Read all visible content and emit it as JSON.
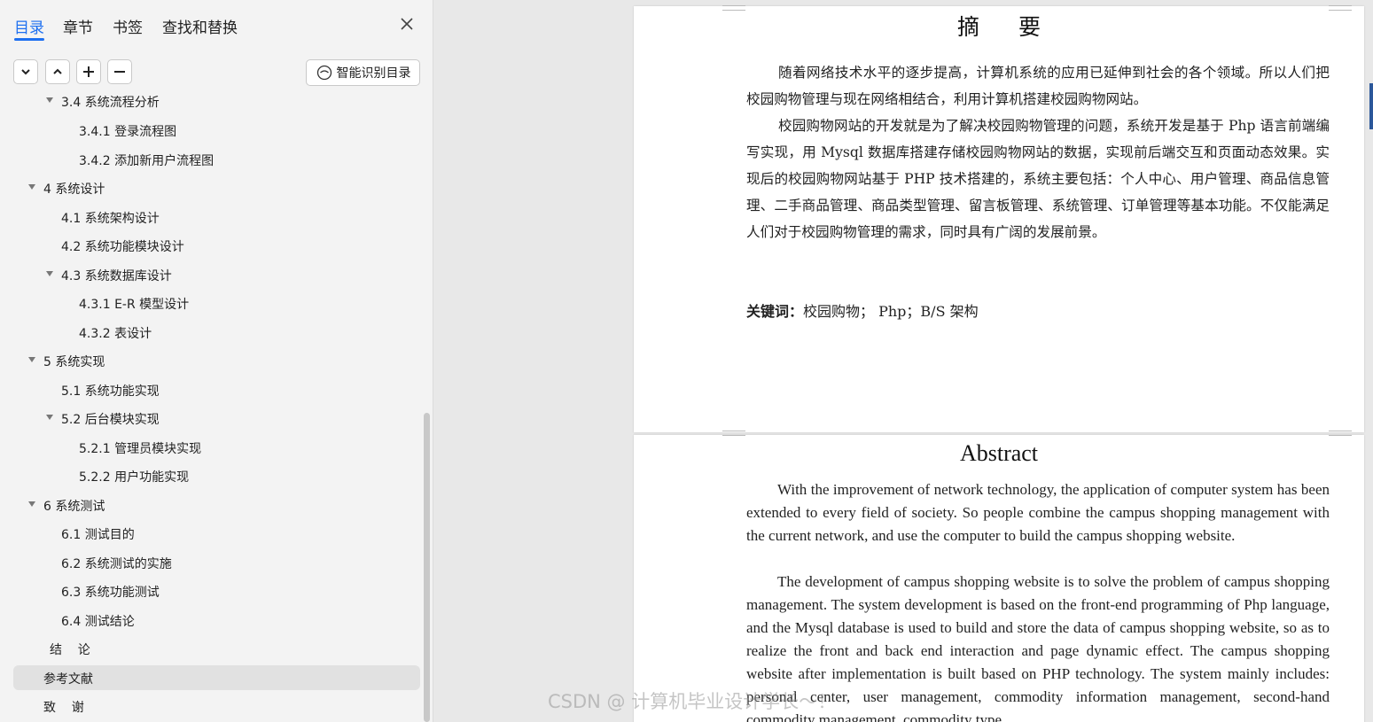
{
  "sidebar": {
    "tabs": [
      {
        "label": "目录"
      },
      {
        "label": "章节"
      },
      {
        "label": "书签"
      },
      {
        "label": "查找和替换"
      }
    ],
    "smart_toc_label": "智能识别目录",
    "toc": [
      {
        "label": "3.4 系统流程分析"
      },
      {
        "label": "3.4.1 登录流程图"
      },
      {
        "label": "3.4.2 添加新用户流程图"
      },
      {
        "label": "4  系统设计"
      },
      {
        "label": "4.1 系统架构设计"
      },
      {
        "label": "4.2 系统功能模块设计"
      },
      {
        "label": "4.3 系统数据库设计"
      },
      {
        "label": "4.3.1 E-R 模型设计"
      },
      {
        "label": "4.3.2 表设计"
      },
      {
        "label": "5 系统实现"
      },
      {
        "label": "5.1 系统功能实现"
      },
      {
        "label": "5.2 后台模块实现"
      },
      {
        "label": "5.2.1 管理员模块实现"
      },
      {
        "label": "5.2.2 用户功能实现"
      },
      {
        "label": "6  系统测试"
      },
      {
        "label": "6.1 测试目的"
      },
      {
        "label": "6.2 系统测试的实施"
      },
      {
        "label": "6.3 系统功能测试"
      },
      {
        "label": "6.4 测试结论"
      },
      {
        "label": "结    论"
      },
      {
        "label": "参考文献"
      },
      {
        "label": "致    谢"
      }
    ]
  },
  "document": {
    "page1": {
      "title": "摘 要",
      "paragraphs": [
        "随着网络技术水平的逐步提高，计算机系统的应用已延伸到社会的各个领域。所以人们把校园购物管理与现在网络相结合，利用计算机搭建校园购物网站。",
        "校园购物网站的开发就是为了解决校园购物管理的问题，系统开发是基于 Php 语言前端编写实现，用 Mysql 数据库搭建存储校园购物网站的数据，实现前后端交互和页面动态效果。实现后的校园购物网站基于 PHP 技术搭建的，系统主要包括：个人中心、用户管理、商品信息管理、二手商品管理、商品类型管理、留言板管理、系统管理、订单管理等基本功能。不仅能满足人们对于校园购物管理的需求，同时具有广阔的发展前景。"
      ],
      "keywords_label": "关键词：",
      "keywords": "校园购物；  Php；B/S 架构"
    },
    "page2": {
      "title": "Abstract",
      "paragraphs": [
        "With the improvement of network technology, the application of computer system has been extended to every field of society. So people combine the campus shopping management with the current network, and use the computer to build the campus shopping website.",
        "The development of campus shopping website is to solve the problem of campus shopping management. The system development is based on the front-end programming of Php language, and the Mysql database is used to build and store the data of campus shopping website, so as to realize the front and back end interaction and page dynamic effect. The campus shopping website after implementation is built based on PHP technology. The system mainly includes: personal center, user management, commodity information management, second-hand commodity management, commodity type"
      ]
    }
  },
  "watermark": "CSDN @ 计算机毕业设计学长～！"
}
